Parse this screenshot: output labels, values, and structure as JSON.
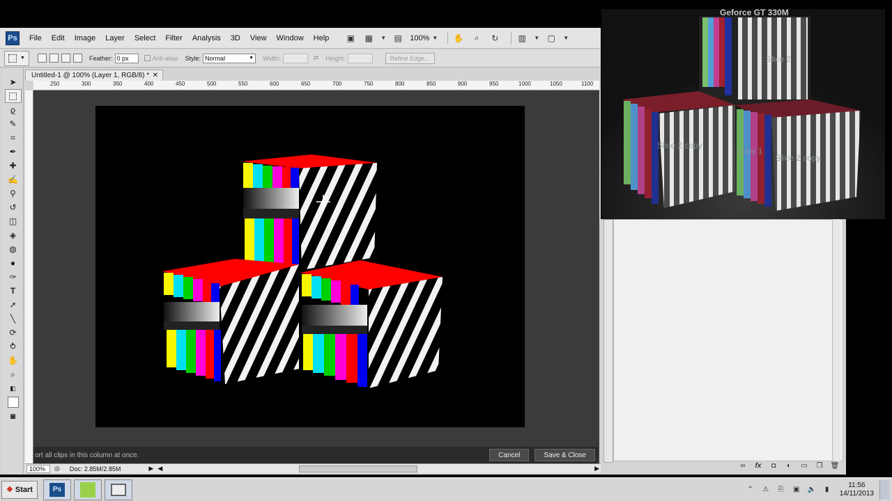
{
  "app": {
    "logo": "Ps"
  },
  "menubar": {
    "items": [
      "File",
      "Edit",
      "Image",
      "Layer",
      "Select",
      "Filter",
      "Analysis",
      "3D",
      "View",
      "Window",
      "Help"
    ],
    "zoom": "100%"
  },
  "options": {
    "feather_label": "Feather:",
    "feather_value": "0 px",
    "antialias_label": "Anti-alias",
    "style_label": "Style:",
    "style_value": "Normal",
    "width_label": "Width:",
    "height_label": "Height:",
    "refine_edge": "Refine Edge..."
  },
  "document": {
    "tab_title": "Untitled-1 @ 100% (Layer 1, RGB/8) *",
    "ruler_ticks": [
      "250",
      "300",
      "350",
      "400",
      "450",
      "500",
      "550",
      "600",
      "650",
      "700",
      "750",
      "800",
      "850",
      "900",
      "950",
      "1000",
      "1050",
      "1100"
    ]
  },
  "status_strip": {
    "message": "ort all clips in this column at once.",
    "cancel": "Cancel",
    "save_close": "Save & Close"
  },
  "statusbar": {
    "zoom": "100%",
    "doc_info": "Doc: 2.85M/2.85M"
  },
  "photo": {
    "gpu_label": "Geforce GT 330M",
    "slice_labels": [
      "Slice 2",
      "Slice 2 copy",
      "copy 1",
      "Slice 2 copy"
    ]
  },
  "taskbar": {
    "start": "Start",
    "time": "11:56",
    "date": "14/11/2013"
  },
  "colors": {
    "red": "#ff0000",
    "yellow": "#f7f700",
    "cyan": "#00e0f0",
    "green": "#00d000",
    "magenta": "#ff00d8",
    "blue": "#0000f0"
  }
}
